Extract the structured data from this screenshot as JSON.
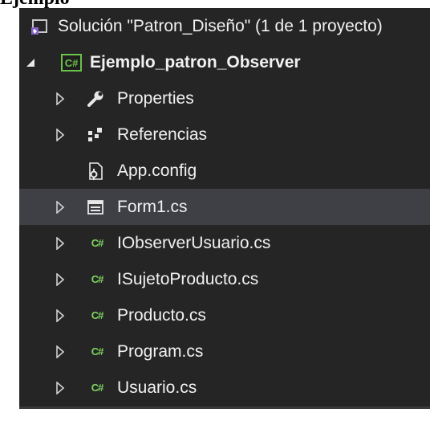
{
  "caption": "Ejemplo",
  "solution": {
    "label": "Solución \"Patron_Diseño\" (1 de 1 proyecto)",
    "icon": "solution-icon"
  },
  "project": {
    "label": "Ejemplo_patron_Observer",
    "icon": "csharp-project-icon",
    "expanded": true
  },
  "items": [
    {
      "label": "Properties",
      "icon": "wrench-icon",
      "expandable": true
    },
    {
      "label": "Referencias",
      "icon": "references-icon",
      "expandable": true
    },
    {
      "label": "App.config",
      "icon": "config-file-icon",
      "expandable": false
    },
    {
      "label": "Form1.cs",
      "icon": "form-icon",
      "expandable": true,
      "selected": true
    },
    {
      "label": "IObserverUsuario.cs",
      "icon": "csharp-file-icon",
      "expandable": true
    },
    {
      "label": "ISujetoProducto.cs",
      "icon": "csharp-file-icon",
      "expandable": true
    },
    {
      "label": "Producto.cs",
      "icon": "csharp-file-icon",
      "expandable": true
    },
    {
      "label": "Program.cs",
      "icon": "csharp-file-icon",
      "expandable": true
    },
    {
      "label": "Usuario.cs",
      "icon": "csharp-file-icon",
      "expandable": true
    }
  ],
  "colors": {
    "background": "#252526",
    "selection": "#3f3f46",
    "text": "#f1f1f1",
    "csharp_green": "#7fd35f"
  }
}
